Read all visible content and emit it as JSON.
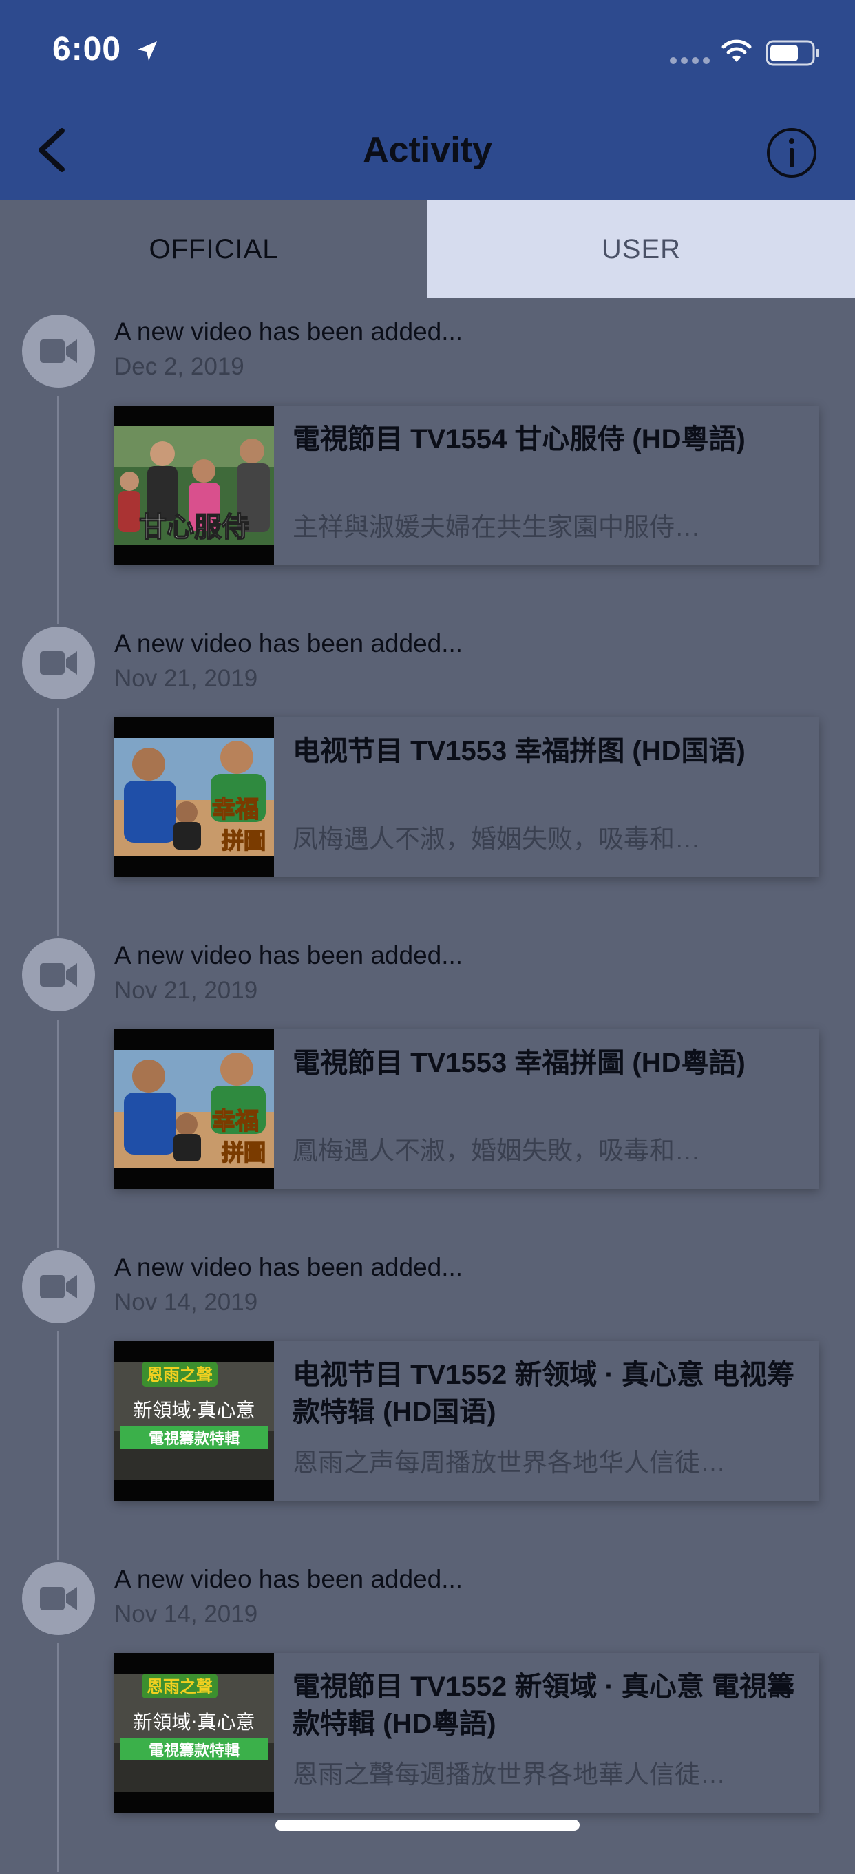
{
  "status_bar": {
    "time": "6:00"
  },
  "nav": {
    "title": "Activity"
  },
  "tabs": [
    {
      "label": "OFFICIAL",
      "selected": true
    },
    {
      "label": "USER",
      "selected": false
    }
  ],
  "items": [
    {
      "message": "A new video has been added...",
      "date": "Dec 2, 2019",
      "video_title": "電視節目 TV1554 甘心服侍 (HD粵語)",
      "video_desc": "主祥與淑媛夫婦在共生家園中服侍…"
    },
    {
      "message": "A new video has been added...",
      "date": "Nov 21, 2019",
      "video_title": "电视节目 TV1553 幸福拼图 (HD国语)",
      "video_desc": "凤梅遇人不淑，婚姻失败，吸毒和…"
    },
    {
      "message": "A new video has been added...",
      "date": "Nov 21, 2019",
      "video_title": "電視節目 TV1553 幸福拼圖 (HD粵語)",
      "video_desc": "鳳梅遇人不淑，婚姻失敗，吸毒和…"
    },
    {
      "message": "A new video has been added...",
      "date": "Nov 14, 2019",
      "video_title": "电视节目 TV1552 新领域 · 真心意 电视筹款特辑 (HD国语)",
      "video_desc": "恩雨之声每周播放世界各地华人信徒…"
    },
    {
      "message": "A new video has been added...",
      "date": "Nov 14, 2019",
      "video_title": "電視節目 TV1552 新領域 · 真心意 電視籌款特輯 (HD粵語)",
      "video_desc": "恩雨之聲每週播放世界各地華人信徒…"
    }
  ],
  "thumbnails": {
    "t1": "甘心服侍",
    "t2a": "幸福",
    "t2b": "拼圖",
    "t3a": "恩雨之聲",
    "t3b": "新領域·真心意",
    "t3c": "電視籌款特輯"
  }
}
